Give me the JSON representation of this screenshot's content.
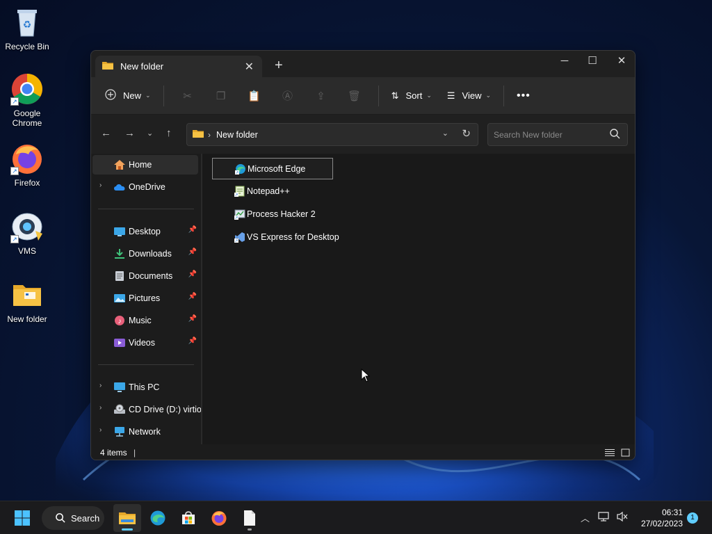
{
  "desktop": {
    "icons": [
      {
        "label": "Recycle Bin"
      },
      {
        "label": "Google Chrome"
      },
      {
        "label": "Firefox"
      },
      {
        "label": "VMS"
      },
      {
        "label": "New folder"
      }
    ]
  },
  "window": {
    "tab_title": "New folder",
    "toolbar": {
      "new_label": "New",
      "sort_label": "Sort",
      "view_label": "View"
    },
    "address": {
      "path_label": "New folder",
      "search_placeholder": "Search New folder"
    },
    "sidebar": {
      "home": "Home",
      "onedrive": "OneDrive",
      "quick": [
        "Desktop",
        "Downloads",
        "Documents",
        "Pictures",
        "Music",
        "Videos"
      ],
      "this_pc": "This PC",
      "cd_drive": "CD Drive (D:) virtio-",
      "network": "Network"
    },
    "files": [
      "Microsoft Edge",
      "Notepad++",
      "Process Hacker 2",
      "VS Express for Desktop"
    ],
    "status": {
      "count": "4 items"
    }
  },
  "taskbar": {
    "search_label": "Search",
    "time": "06:31",
    "date": "27/02/2023",
    "notification_count": "1"
  },
  "colors": {
    "accent": "#60cdff",
    "folder": "#f6c244",
    "window_bg": "#1c1c1c"
  }
}
